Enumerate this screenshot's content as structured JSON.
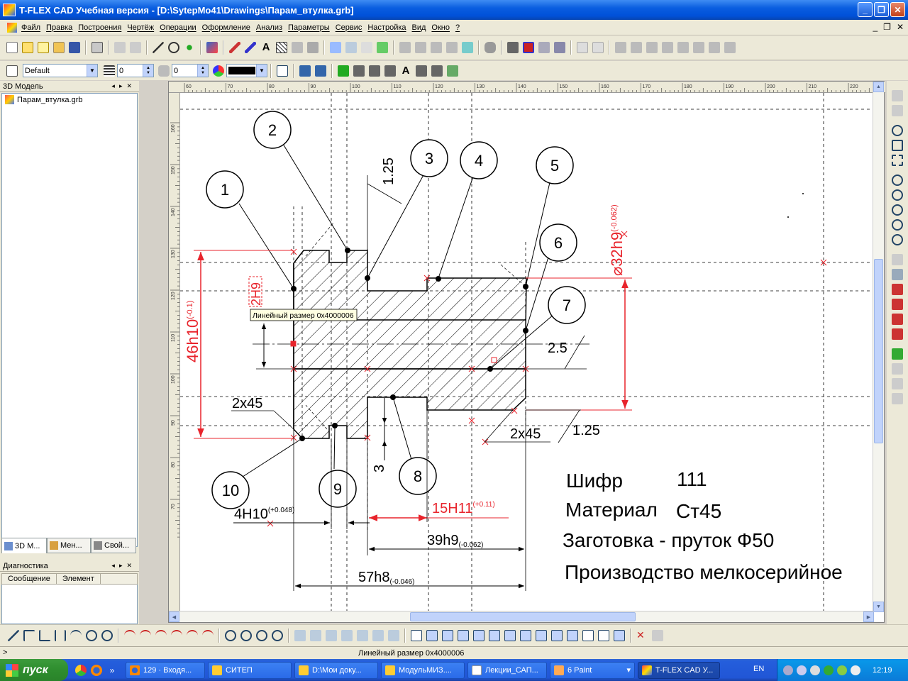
{
  "window": {
    "title": "T-FLEX CAD Учебная версия - [D:\\SytepMo41\\Drawings\\Парам_втулка.grb]"
  },
  "menu": [
    "Файл",
    "Правка",
    "Построения",
    "Чертёж",
    "Операции",
    "Оформление",
    "Анализ",
    "Параметры",
    "Сервис",
    "Настройка",
    "Вид",
    "Окно",
    "?"
  ],
  "toolbar2": {
    "style": "Default",
    "layer_value": "0",
    "width_value": "0",
    "color": "#000000"
  },
  "left_panel": {
    "title": "3D Модель",
    "tree_item": "Парам_втулка.grb",
    "tabs": [
      "3D М...",
      "Мен...",
      "Свой..."
    ]
  },
  "diagnostics": {
    "title": "Диагностика",
    "columns": [
      "Сообщение",
      "Элемент"
    ]
  },
  "ruler": {
    "h_ticks": [
      "60",
      "70",
      "80",
      "90",
      "100",
      "110",
      "120",
      "130",
      "140",
      "150",
      "160",
      "170",
      "180",
      "190",
      "200",
      "210",
      "220"
    ],
    "v_ticks": [
      "160",
      "150",
      "140",
      "130",
      "120",
      "110",
      "100",
      "90",
      "80",
      "70"
    ]
  },
  "drawing": {
    "balloons": [
      "1",
      "2",
      "3",
      "4",
      "5",
      "6",
      "7",
      "8",
      "9",
      "10"
    ],
    "dim_46h10": "46h10",
    "dim_46h10_tol": "(-0.1)",
    "dim_32h9": "⌀32h9",
    "dim_32h9_tol": "(-0.062)",
    "dim_2h9": "2H9",
    "dim_125_top": "1.25",
    "dim_125_bottom": "1.25",
    "dim_25": "2.5",
    "dim_2x45_left": "2x45",
    "dim_2x45_right": "2x45",
    "dim_3": "3",
    "dim_4h10": "4H10",
    "dim_4h10_tol": "(+0.048)",
    "dim_15h11": "15H11",
    "dim_15h11_tol": "(+0.11)",
    "dim_39h9": "39h9",
    "dim_39h9_tol": "(-0.062)",
    "dim_57h8": "57h8",
    "dim_57h8_tol": "(-0.046)",
    "tooltip": "Линейный размер 0x4000006",
    "cipher_label": "Шифр",
    "cipher_value": "111",
    "material_label": "Материал",
    "material_value": "Ст45",
    "blank": "Заготовка - пруток Ф50",
    "production": "Производство мелкосерийное"
  },
  "statusbar": {
    "prompt": ">",
    "text": "Линейный размер 0x4000006"
  },
  "taskbar": {
    "start": "пуск",
    "tasks": [
      "129 · Входя...",
      "СИТЕП",
      "D:\\Мои доку...",
      "МодульМИЗ....",
      "Лекции_САП...",
      "6 Paint",
      "T-FLEX CAD У..."
    ],
    "lang": "EN",
    "clock": "12:19"
  },
  "colors": {
    "accent_red": "#e8242c",
    "xp_blue": "#245edc",
    "panel": "#ece9d8"
  }
}
